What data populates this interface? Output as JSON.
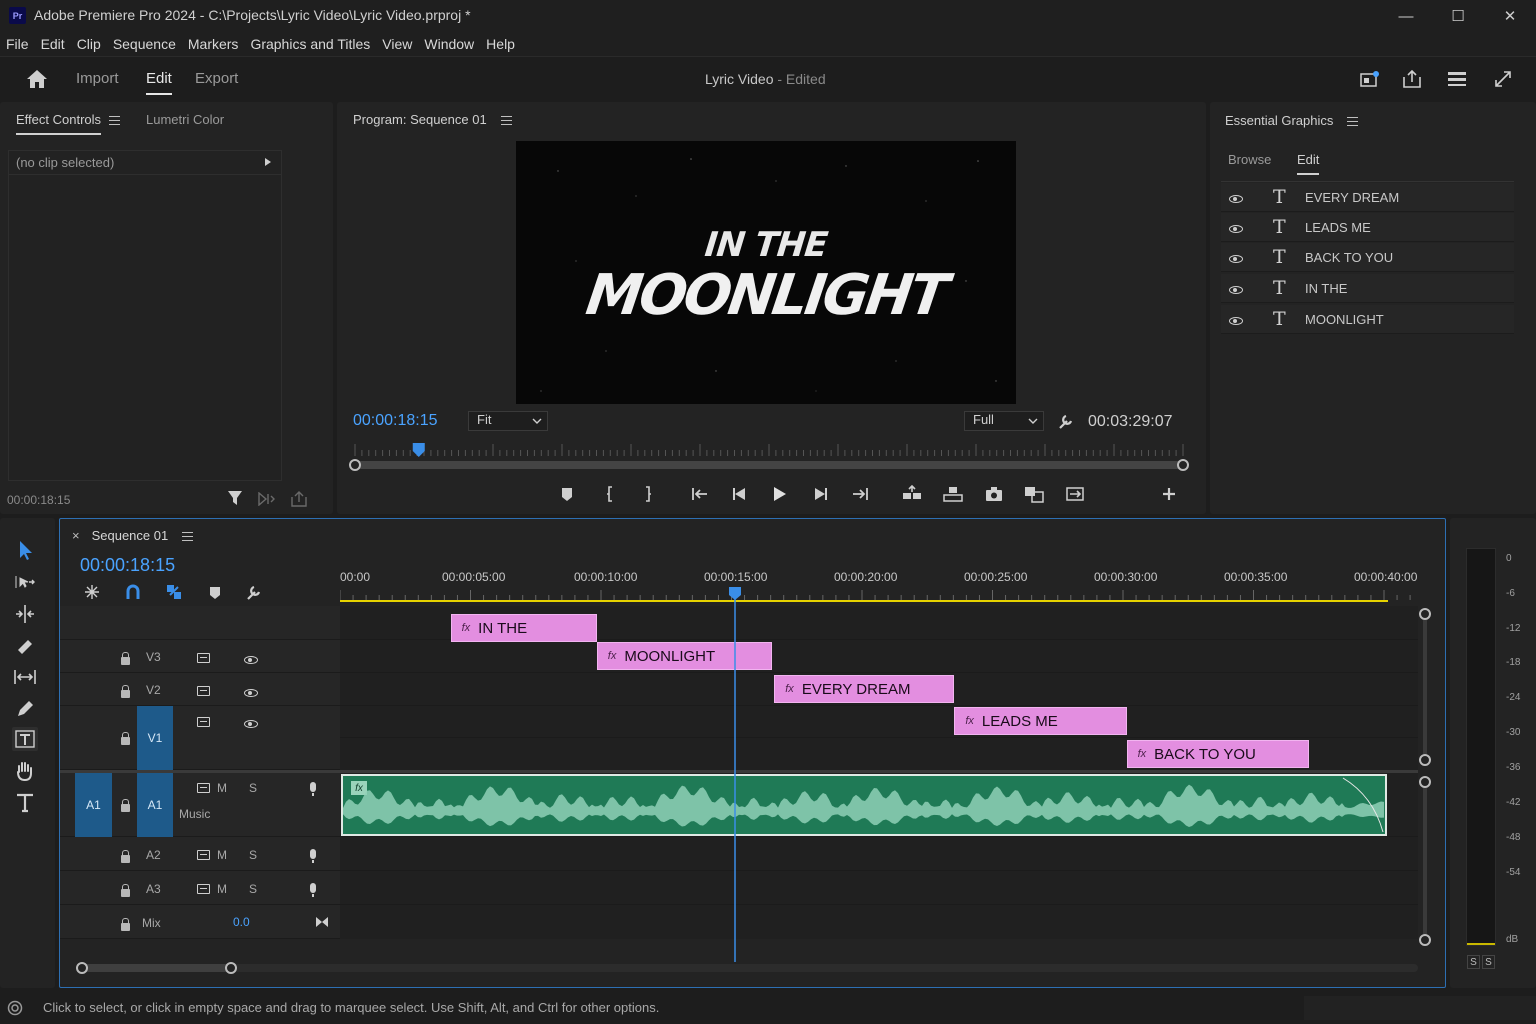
{
  "app": {
    "title": "Adobe Premiere Pro 2024 - C:\\Projects\\Lyric Video\\Lyric Video.prproj *",
    "logo": "Pr"
  },
  "window_controls": {
    "minimize": "—",
    "maximize": "☐",
    "close": "✕"
  },
  "menu": [
    "File",
    "Edit",
    "Clip",
    "Sequence",
    "Markers",
    "Graphics and Titles",
    "View",
    "Window",
    "Help"
  ],
  "header": {
    "tabs": [
      "Import",
      "Edit",
      "Export"
    ],
    "active_tab": "Edit",
    "project_name": "Lyric Video",
    "project_state": " - Edited"
  },
  "effect_controls": {
    "tab_label": "Effect Controls",
    "lumetri_label": "Lumetri Color",
    "clip_label": "(no clip selected)",
    "timecode": "00:00:18:15"
  },
  "program": {
    "title": "Program: Sequence 01",
    "line1": "IN THE",
    "line2": "MOONLIGHT",
    "timecode": "00:00:18:15",
    "fit": "Fit",
    "quality": "Full",
    "duration": "00:03:29:07",
    "playhead_fraction": 0.077
  },
  "essential_graphics": {
    "title": "Essential Graphics",
    "tabs": [
      "Browse",
      "Edit"
    ],
    "active_tab": "Edit",
    "layers": [
      "EVERY DREAM",
      "LEADS ME",
      "BACK TO YOU",
      "IN THE",
      "MOONLIGHT"
    ]
  },
  "sequence": {
    "name": "Sequence 01",
    "close": "×",
    "timecode": "00:00:18:15",
    "ruler": [
      "00:00",
      "00:00:05:00",
      "00:00:10:00",
      "00:00:15:00",
      "00:00:20:00",
      "00:00:25:00",
      "00:00:30:00",
      "00:00:35:00",
      "00:00:40:00"
    ],
    "playhead_seconds": 15.1,
    "tracks": {
      "v3": "V3",
      "v2": "V2",
      "v1": "V1",
      "a1_src": "A1",
      "a1": "A1",
      "a1_name": "Music",
      "a2": "A2",
      "a3": "A3",
      "mix": "Mix",
      "mix_value": "0.0",
      "m": "M",
      "s": "S"
    },
    "clips": [
      {
        "label": "IN THE",
        "track": "top",
        "start": 4.2,
        "end": 9.8
      },
      {
        "label": "MOONLIGHT",
        "track": "v3",
        "start": 9.8,
        "end": 16.5
      },
      {
        "label": "EVERY DREAM",
        "track": "v2",
        "start": 16.6,
        "end": 23.5
      },
      {
        "label": "LEADS ME",
        "track": "v1a",
        "start": 23.5,
        "end": 30.1
      },
      {
        "label": "BACK TO YOU",
        "track": "v1b",
        "start": 30.1,
        "end": 37.1
      }
    ],
    "fx_label": "fx"
  },
  "meter": {
    "labels": [
      "0",
      "-6",
      "-12",
      "-18",
      "-24",
      "-30",
      "-36",
      "-42",
      "-48",
      "-54",
      "dB"
    ],
    "solo": [
      "S",
      "S"
    ]
  },
  "status": {
    "text": "Click to select, or click in empty space and drag to marquee select. Use Shift, Alt, and Ctrl for other options."
  },
  "colors": {
    "accent": "#4aa3ff",
    "graphic_clip": "#e38ee0",
    "audio_clip": "#1f7a56",
    "work_area": "#e6d200"
  }
}
